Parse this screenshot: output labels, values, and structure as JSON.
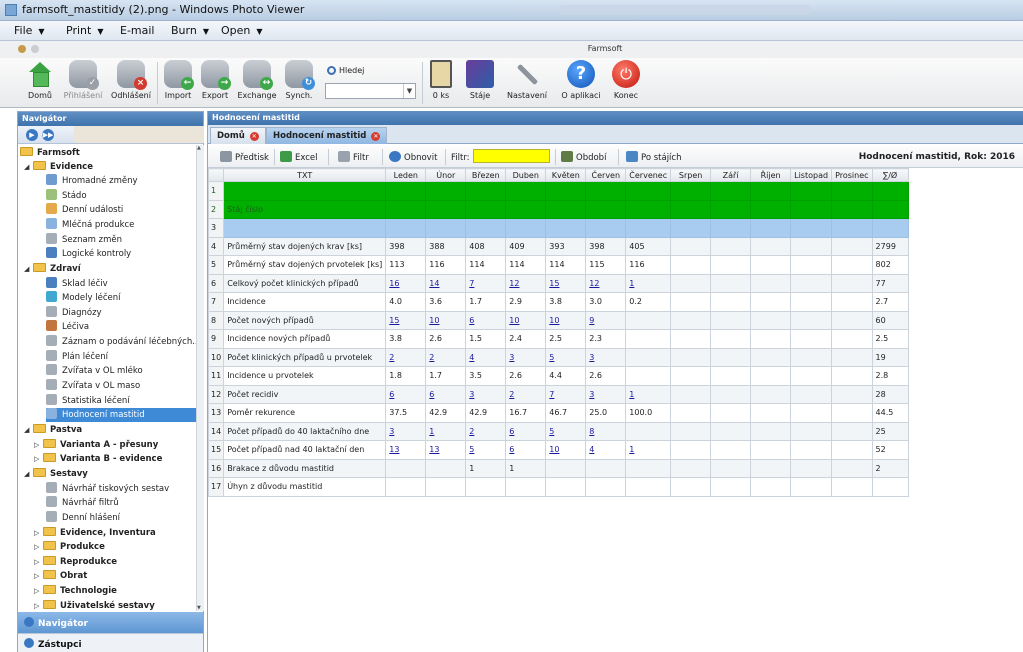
{
  "window": {
    "title": "farmsoft_mastitidy (2).png - Windows Photo Viewer"
  },
  "menu": [
    {
      "label": "File",
      "dropdown": true
    },
    {
      "label": "Print",
      "dropdown": true
    },
    {
      "label": "E-mail",
      "dropdown": false
    },
    {
      "label": "Burn",
      "dropdown": true
    },
    {
      "label": "Open",
      "dropdown": true
    }
  ],
  "app": {
    "title": "Farmsoft"
  },
  "toolbar": {
    "home": "Domů",
    "login": "Přihlášení",
    "logout": "Odhlášení",
    "import": "Import",
    "export": "Export",
    "exchange": "Exchange",
    "synch": "Synch.",
    "search_label": "Hledej",
    "count": "0 ks",
    "herds": "Stáje",
    "settings": "Nastavení",
    "about": "O aplikaci",
    "exit": "Konec"
  },
  "navigator": {
    "header": "Navigátor",
    "root": "Farmsoft",
    "groups": {
      "evidence": "Evidence",
      "zdravi": "Zdraví",
      "pastva": "Pastva",
      "sestavy": "Sestavy"
    },
    "evidence_items": [
      "Hromadné změny",
      "Stádo",
      "Denní události",
      "Mléčná produkce",
      "Seznam změn",
      "Logické kontroly"
    ],
    "zdravi_items": [
      "Sklad léčiv",
      "Modely léčení",
      "Diagnózy",
      "Léčiva",
      "Záznam o podávání léčebných...",
      "Plán léčení",
      "Zvířata v OL mléko",
      "Zvířata v OL maso",
      "Statistika léčení",
      "Hodnocení mastitid"
    ],
    "pastva_items": [
      "Varianta A - přesuny",
      "Varianta B - evidence"
    ],
    "sestavy_items": [
      "Návrhář tiskových sestav",
      "Návrhář filtrů",
      "Denní hlášení"
    ],
    "other_groups": [
      "Evidence, Inventura",
      "Produkce",
      "Reprodukce",
      "Obrat",
      "Technologie",
      "Uživatelské sestavy"
    ],
    "footer_1": "Navigátor",
    "footer_2": "Zástupci"
  },
  "main": {
    "header": "Hodnocení mastitid",
    "tabs": [
      "Domů",
      "Hodnocení mastitid"
    ],
    "subtoolbar": {
      "preview": "Předtisk",
      "excel": "Excel",
      "filter": "Filtr",
      "refresh": "Obnovit",
      "filter_label": "Filtr:",
      "period": "Období",
      "by_herd": "Po stájích"
    },
    "report_title": "Hodnocení mastitid, Rok: 2016"
  },
  "table": {
    "columns": [
      "TXT",
      "Leden",
      "Únor",
      "Březen",
      "Duben",
      "Květen",
      "Červen",
      "Červenec",
      "Srpen",
      "Září",
      "Říjen",
      "Listopad",
      "Prosinec",
      "∑/Ø"
    ],
    "rows": [
      {
        "n": "1",
        "style": "green",
        "cells": [
          "",
          "",
          "",
          "",
          "",
          "",
          "",
          "",
          "",
          "",
          "",
          "",
          "",
          ""
        ]
      },
      {
        "n": "2",
        "style": "green",
        "cells": [
          "Stáj číslo",
          "",
          "",
          "",
          "",
          "",
          "",
          "",
          "",
          "",
          "",
          "",
          "",
          ""
        ]
      },
      {
        "n": "3",
        "style": "blue",
        "cells": [
          "",
          "",
          "",
          "",
          "",
          "",
          "",
          "",
          "",
          "",
          "",
          "",
          "",
          ""
        ]
      },
      {
        "n": "4",
        "style": "alt",
        "cells": [
          "Průměrný stav dojených krav [ks]",
          "398",
          "388",
          "408",
          "409",
          "393",
          "398",
          "405",
          "",
          "",
          "",
          "",
          "",
          "2799"
        ]
      },
      {
        "n": "5",
        "style": "",
        "cells": [
          "Průměrný stav dojených prvotelek [ks]",
          "113",
          "116",
          "114",
          "114",
          "114",
          "115",
          "116",
          "",
          "",
          "",
          "",
          "",
          "802"
        ]
      },
      {
        "n": "6",
        "style": "alt",
        "link": true,
        "cells": [
          "Celkový počet klinických případů",
          "16",
          "14",
          "7",
          "12",
          "15",
          "12",
          "1",
          "",
          "",
          "",
          "",
          "",
          "77"
        ]
      },
      {
        "n": "7",
        "style": "",
        "cells": [
          "Incidence",
          "4.0",
          "3.6",
          "1.7",
          "2.9",
          "3.8",
          "3.0",
          "0.2",
          "",
          "",
          "",
          "",
          "",
          "2.7"
        ]
      },
      {
        "n": "8",
        "style": "alt",
        "link": true,
        "cells": [
          "Počet nových případů",
          "15",
          "10",
          "6",
          "10",
          "10",
          "9",
          "",
          "",
          "",
          "",
          "",
          "",
          "60"
        ]
      },
      {
        "n": "9",
        "style": "",
        "cells": [
          "Incidence nových případů",
          "3.8",
          "2.6",
          "1.5",
          "2.4",
          "2.5",
          "2.3",
          "",
          "",
          "",
          "",
          "",
          "",
          "2.5"
        ]
      },
      {
        "n": "10",
        "style": "alt",
        "link": true,
        "cells": [
          "Počet klinických případů u prvotelek",
          "2",
          "2",
          "4",
          "3",
          "5",
          "3",
          "",
          "",
          "",
          "",
          "",
          "",
          "19"
        ]
      },
      {
        "n": "11",
        "style": "",
        "cells": [
          "Incidence u prvotelek",
          "1.8",
          "1.7",
          "3.5",
          "2.6",
          "4.4",
          "2.6",
          "",
          "",
          "",
          "",
          "",
          "",
          "2.8"
        ]
      },
      {
        "n": "12",
        "style": "alt",
        "link": true,
        "cells": [
          "Počet recidiv",
          "6",
          "6",
          "3",
          "2",
          "7",
          "3",
          "1",
          "",
          "",
          "",
          "",
          "",
          "28"
        ]
      },
      {
        "n": "13",
        "style": "",
        "cells": [
          "Poměr rekurence",
          "37.5",
          "42.9",
          "42.9",
          "16.7",
          "46.7",
          "25.0",
          "100.0",
          "",
          "",
          "",
          "",
          "",
          "44.5"
        ]
      },
      {
        "n": "14",
        "style": "alt",
        "link": true,
        "cells": [
          "Počet případů do 40 laktačního dne",
          "3",
          "1",
          "2",
          "6",
          "5",
          "8",
          "",
          "",
          "",
          "",
          "",
          "",
          "25"
        ]
      },
      {
        "n": "15",
        "style": "",
        "link": true,
        "cells": [
          "Počet případů nad 40 laktační den",
          "13",
          "13",
          "5",
          "6",
          "10",
          "4",
          "1",
          "",
          "",
          "",
          "",
          "",
          "52"
        ]
      },
      {
        "n": "16",
        "style": "alt",
        "cells": [
          "Brakace z důvodu mastitid",
          "",
          "",
          "1",
          "1",
          "",
          "",
          "",
          "",
          "",
          "",
          "",
          "",
          "2"
        ]
      },
      {
        "n": "17",
        "style": "",
        "cells": [
          "Úhyn z důvodu mastitid",
          "",
          "",
          "",
          "",
          "",
          "",
          "",
          "",
          "",
          "",
          "",
          "",
          ""
        ]
      }
    ]
  },
  "colors": {
    "accent": "#3f73ad",
    "row_green": "#00b000",
    "row_blue": "#a8ccf0",
    "filter_bg": "#ffff00",
    "link": "#1a1aa0"
  }
}
